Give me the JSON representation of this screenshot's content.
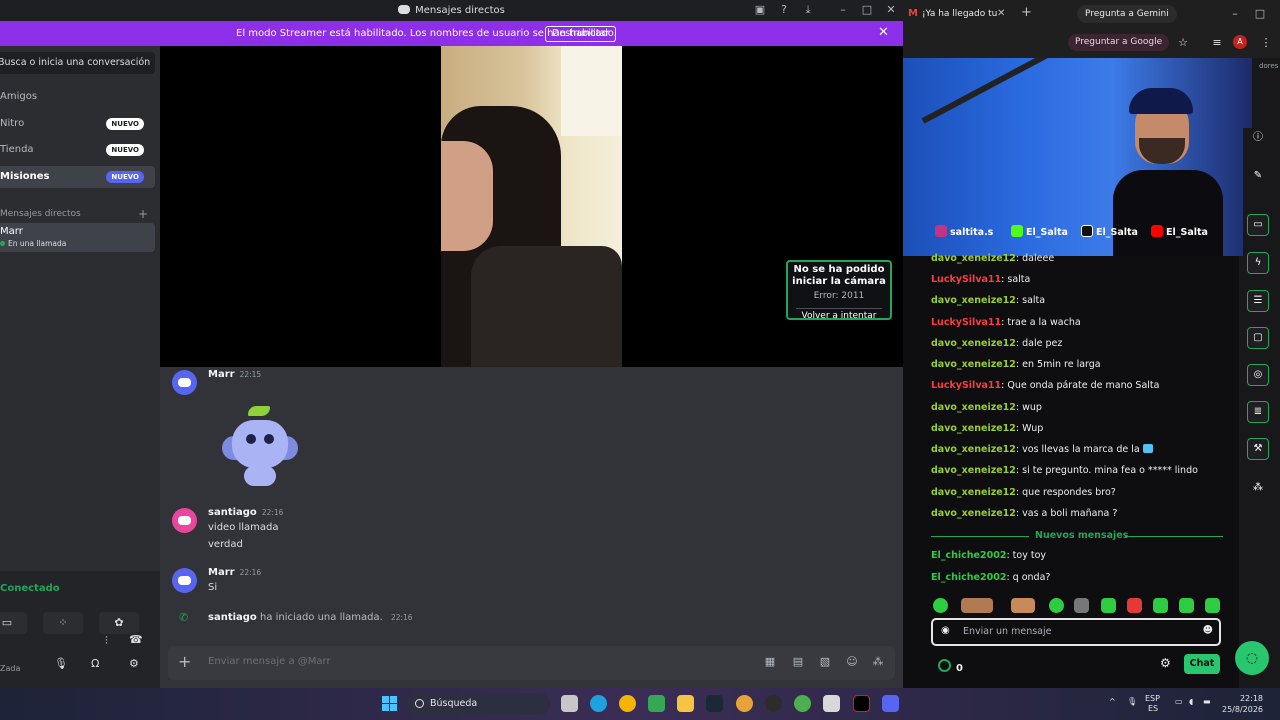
{
  "discord": {
    "window_title": "Mensajes directos",
    "banner": {
      "text": "El modo Streamer está habilitado. Los nombres de usuario se han truncado.",
      "button": "Deshabilitar"
    },
    "sidebar": {
      "search": "Busca o inicia una conversación",
      "items": [
        {
          "label": "Amigos",
          "badge": ""
        },
        {
          "label": "Nitro",
          "badge": "NUEVO"
        },
        {
          "label": "Tienda",
          "badge": "NUEVO"
        },
        {
          "label": "Misiones",
          "badge": "NUEVO"
        }
      ],
      "dm_header": "Mensajes directos",
      "dm_item": {
        "name": "Marr",
        "status": "En una llamada"
      },
      "voice_status": "Conectado",
      "user_label": "Zada"
    },
    "camera_error": {
      "title": "No se ha podido iniciar la cámara",
      "code": "Error: 2011",
      "retry": "Volver a intentar"
    },
    "messages": [
      {
        "author": "Marr",
        "time": "22:15",
        "lines": []
      },
      {
        "author": "santiago",
        "time": "22:16",
        "lines": [
          "video llamada",
          "verdad"
        ]
      },
      {
        "author": "Marr",
        "time": "22:16",
        "lines": [
          "Si"
        ]
      }
    ],
    "call_event": {
      "author": "santiago",
      "text": "ha iniciado una llamada.",
      "time": "22:16"
    },
    "composer_placeholder": "Enviar mensaje a @Marr"
  },
  "browser": {
    "tab_title": "¡Ya ha llegado tu",
    "gemini_button": "Pregunta a Gemini",
    "ask_google": "Preguntar a Google",
    "avatar_letter": "A",
    "right_text": "dores",
    "stream_overlay": [
      {
        "name": "saltita.s",
        "color": "#c13584"
      },
      {
        "name": "El_Salta",
        "color": "#53fc18"
      },
      {
        "name": "El_Salta",
        "color": "#111111"
      },
      {
        "name": "El_Salta",
        "color": "#ff0000"
      }
    ],
    "chat": {
      "messages": [
        {
          "user": "davo_xeneize12",
          "text": "daleee",
          "color": "#9acd32"
        },
        {
          "user": "LuckySilva11",
          "text": "salta",
          "color": "#ff3b3b"
        },
        {
          "user": "davo_xeneize12",
          "text": "salta",
          "color": "#9acd32"
        },
        {
          "user": "LuckySilva11",
          "text": "trae a la wacha",
          "color": "#ff3b3b"
        },
        {
          "user": "davo_xeneize12",
          "text": "dale pez",
          "color": "#9acd32"
        },
        {
          "user": "davo_xeneize12",
          "text": "en 5min re larga",
          "color": "#9acd32"
        },
        {
          "user": "LuckySilva11",
          "text": "Que onda párate de mano Salta",
          "color": "#ff3b3b"
        },
        {
          "user": "davo_xeneize12",
          "text": "wup",
          "color": "#9acd32"
        },
        {
          "user": "davo_xeneize12",
          "text": "Wup",
          "color": "#9acd32"
        },
        {
          "user": "davo_xeneize12",
          "text": "vos llevas la marca de la",
          "color": "#9acd32"
        },
        {
          "user": "davo_xeneize12",
          "text": "si te pregunto. mina fea o ***** lindo",
          "color": "#9acd32"
        },
        {
          "user": "davo_xeneize12",
          "text": "que respondes bro?",
          "color": "#9acd32"
        },
        {
          "user": "davo_xeneize12",
          "text": "vas a boli mañana ?",
          "color": "#9acd32"
        }
      ],
      "separator": "Nuevos mensajes",
      "new_messages": [
        {
          "user": "El_chiche2002",
          "text": "toy toy",
          "color": "#2ecc40"
        },
        {
          "user": "El_chiche2002",
          "text": "q onda?",
          "color": "#2ecc40"
        }
      ],
      "input_placeholder": "Enviar un mensaje",
      "points": "0",
      "chat_button": "Chat"
    }
  },
  "taskbar": {
    "search": "Búsqueda",
    "lang_top": "ESP",
    "lang_bottom": "ES",
    "time": "22:18",
    "date": "25/8/2026"
  }
}
